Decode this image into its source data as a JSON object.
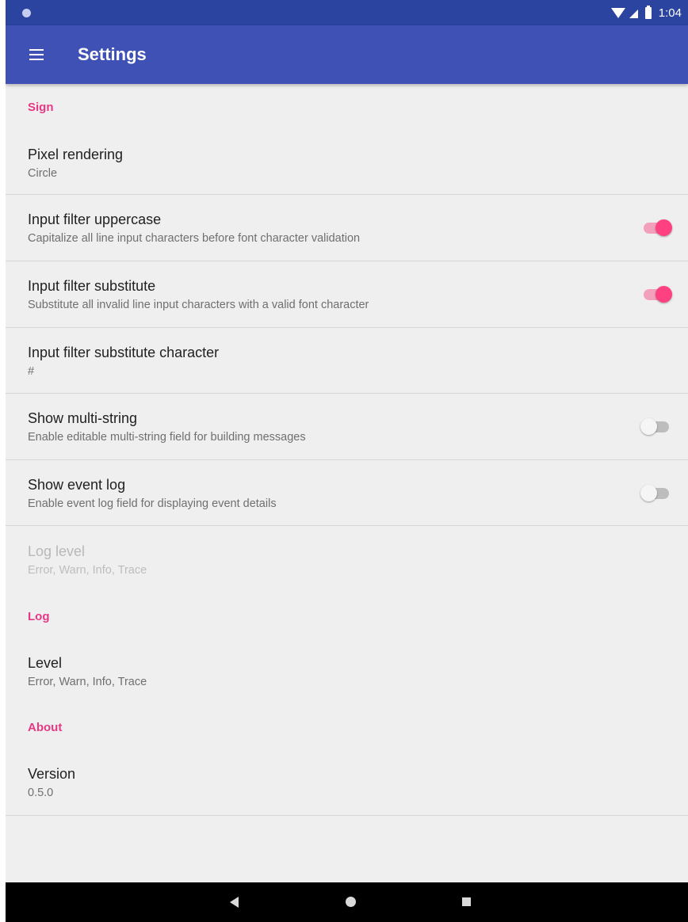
{
  "status_bar": {
    "time": "1:04"
  },
  "toolbar": {
    "title": "Settings"
  },
  "categories": {
    "sign": "Sign",
    "log": "Log",
    "about": "About"
  },
  "prefs": {
    "pixel_rendering": {
      "title": "Pixel rendering",
      "summary": "Circle"
    },
    "uppercase": {
      "title": "Input filter uppercase",
      "summary": "Capitalize all line input characters before font character validation",
      "checked": true
    },
    "substitute": {
      "title": "Input filter substitute",
      "summary": "Substitute all invalid line input characters with a valid font character",
      "checked": true
    },
    "substitute_char": {
      "title": "Input filter substitute character",
      "summary": "#"
    },
    "multi_string": {
      "title": "Show multi-string",
      "summary": "Enable editable multi-string field for building messages",
      "checked": false
    },
    "event_log": {
      "title": "Show event log",
      "summary": "Enable event log field for displaying event details",
      "checked": false
    },
    "log_level_disabled": {
      "title": "Log level",
      "summary": "Error, Warn, Info, Trace",
      "enabled": false
    },
    "level": {
      "title": "Level",
      "summary": "Error, Warn, Info, Trace"
    },
    "version": {
      "title": "Version",
      "summary": "0.5.0"
    }
  },
  "colors": {
    "primary": "#3f51b5",
    "primary_dark": "#2a44a0",
    "accent": "#ff4081",
    "category_text": "#e53984"
  },
  "icons": {
    "menu": "hamburger-menu-icon",
    "wifi": "wifi-icon",
    "signal": "signal-icon",
    "battery": "battery-icon",
    "back": "back-icon",
    "home": "home-icon",
    "recents": "recents-icon"
  }
}
